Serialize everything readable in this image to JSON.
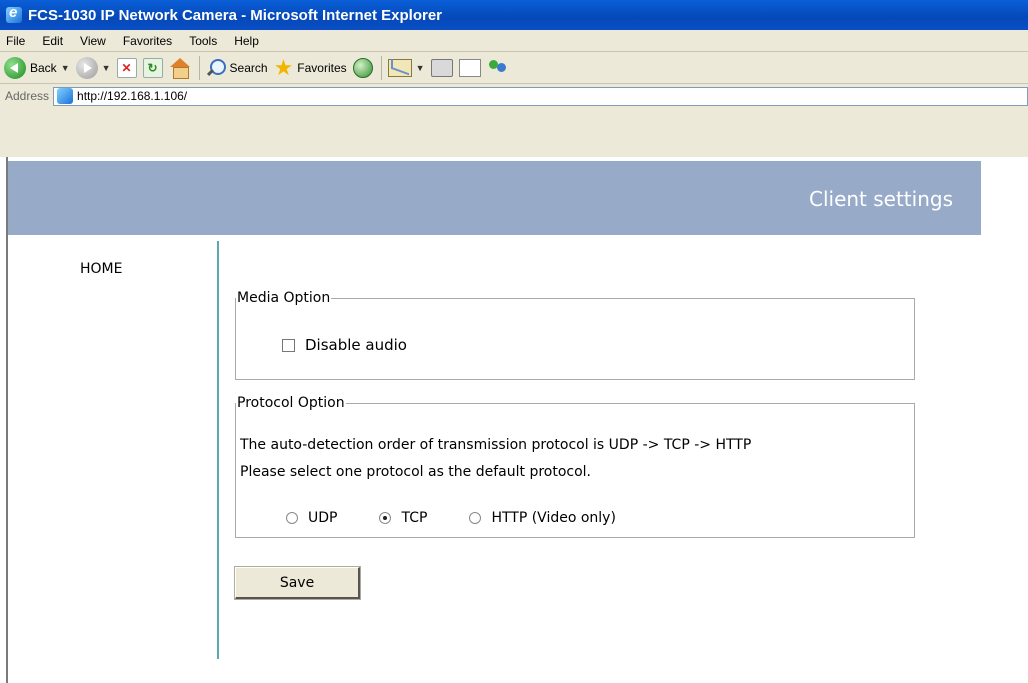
{
  "window": {
    "title": "FCS-1030 IP Network Camera - Microsoft Internet Explorer"
  },
  "menu": {
    "items": [
      "File",
      "Edit",
      "View",
      "Favorites",
      "Tools",
      "Help"
    ]
  },
  "toolbar": {
    "back_label": "Back",
    "search_label": "Search",
    "favorites_label": "Favorites"
  },
  "address": {
    "label": "Address",
    "url": "http://192.168.1.106/"
  },
  "page": {
    "banner_title": "Client settings",
    "nav_home": "HOME",
    "media_option": {
      "legend": "Media Option",
      "disable_audio_label": "Disable audio",
      "disable_audio_checked": false
    },
    "protocol_option": {
      "legend": "Protocol Option",
      "line1": "The auto-detection order of transmission protocol is UDP -> TCP -> HTTP",
      "line2": "Please select one protocol as the default protocol.",
      "options": [
        "UDP",
        "TCP",
        "HTTP (Video only)"
      ],
      "selected": "TCP"
    },
    "save_label": "Save"
  }
}
